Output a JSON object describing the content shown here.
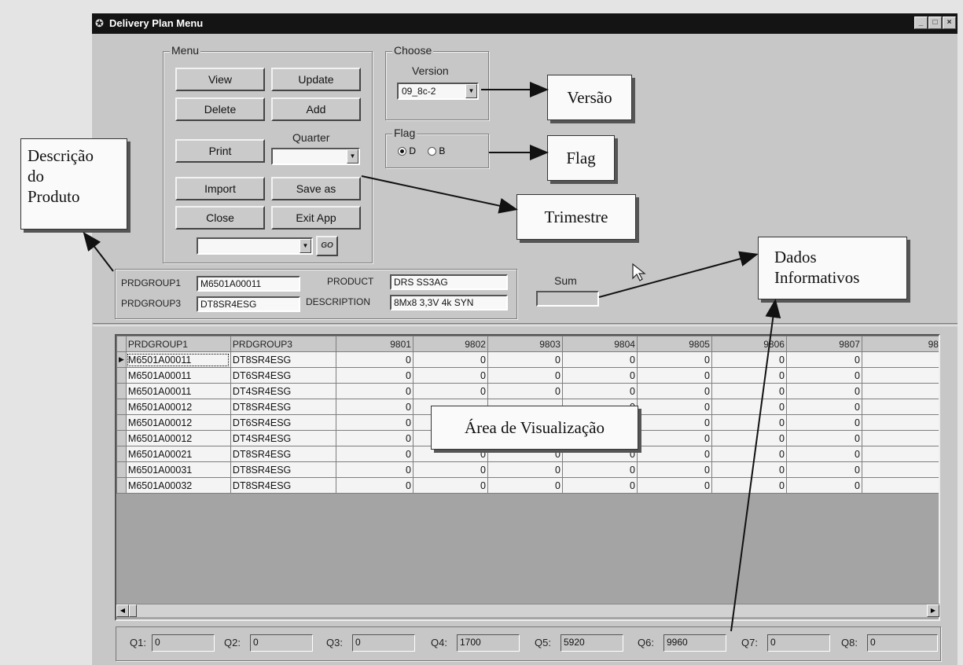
{
  "window": {
    "title": "Delivery Plan Menu",
    "min": "_",
    "max": "□",
    "close": "×"
  },
  "menu": {
    "label": "Menu",
    "view": "View",
    "update": "Update",
    "delete": "Delete",
    "add": "Add",
    "print": "Print",
    "quarter_label": "Quarter",
    "quarter_value": "",
    "import": "Import",
    "save_as": "Save as",
    "close": "Close",
    "exit_app": "Exit App",
    "go_select_value": "",
    "go": "GO"
  },
  "choose": {
    "label": "Choose",
    "version_label": "Version",
    "version_value": "09_8c-2"
  },
  "flag": {
    "label": "Flag",
    "option_d": "D",
    "option_b": "B",
    "selected": "D"
  },
  "info": {
    "prdgroup1_label": "PRDGROUP1",
    "prdgroup1_value": "M6501A00011",
    "prdgroup3_label": "PRDGROUP3",
    "prdgroup3_value": "DT8SR4ESG",
    "product_label": "PRODUCT",
    "product_value": "DRS SS3AG",
    "description_label": "DESCRIPTION",
    "description_value": "8Mx8 3,3V 4k SYN"
  },
  "sum": {
    "label": "Sum",
    "value": ""
  },
  "grid": {
    "columns": [
      "PRDGROUP1",
      "PRDGROUP3",
      "9801",
      "9802",
      "9803",
      "9804",
      "9805",
      "9806",
      "9807",
      "98"
    ],
    "rows": [
      [
        "M6501A00011",
        "DT8SR4ESG",
        "0",
        "0",
        "0",
        "0",
        "0",
        "0",
        "0",
        ""
      ],
      [
        "M6501A00011",
        "DT6SR4ESG",
        "0",
        "0",
        "0",
        "0",
        "0",
        "0",
        "0",
        ""
      ],
      [
        "M6501A00011",
        "DT4SR4ESG",
        "0",
        "0",
        "0",
        "0",
        "0",
        "0",
        "0",
        ""
      ],
      [
        "M6501A00012",
        "DT8SR4ESG",
        "0",
        "",
        "",
        "0",
        "0",
        "0",
        "0",
        ""
      ],
      [
        "M6501A00012",
        "DT6SR4ESG",
        "0",
        "",
        "",
        "0",
        "0",
        "0",
        "0",
        ""
      ],
      [
        "M6501A00012",
        "DT4SR4ESG",
        "0",
        "",
        "",
        "0",
        "0",
        "0",
        "0",
        ""
      ],
      [
        "M6501A00021",
        "DT8SR4ESG",
        "0",
        "0",
        "0",
        "0",
        "0",
        "0",
        "0",
        ""
      ],
      [
        "M6501A00031",
        "DT8SR4ESG",
        "0",
        "0",
        "0",
        "0",
        "0",
        "0",
        "0",
        ""
      ],
      [
        "M6501A00032",
        "DT8SR4ESG",
        "0",
        "0",
        "0",
        "0",
        "0",
        "0",
        "0",
        ""
      ]
    ]
  },
  "status": [
    {
      "label": "Q1:",
      "value": "0"
    },
    {
      "label": "Q2:",
      "value": "0"
    },
    {
      "label": "Q3:",
      "value": "0"
    },
    {
      "label": "Q4:",
      "value": "1700"
    },
    {
      "label": "Q5:",
      "value": "5920"
    },
    {
      "label": "Q6:",
      "value": "9960"
    },
    {
      "label": "Q7:",
      "value": "0"
    },
    {
      "label": "Q8:",
      "value": "0"
    }
  ],
  "callouts": {
    "versao": "Versão",
    "flag": "Flag",
    "trimestre": "Trimestre",
    "descricao": "Descrição do Produto",
    "descricao_l1": "Descrição",
    "descricao_l2": "do",
    "descricao_l3": "Produto",
    "dados": "Dados Informativos",
    "dados_l1": "Dados",
    "dados_l2": "Informativos",
    "area": "Área de Visualização"
  },
  "icons": {
    "row_pointer": "triangle-right-icon",
    "dropdown": "chevron-down-icon",
    "cursor": "mouse-pointer-icon",
    "app": "app-icon"
  }
}
